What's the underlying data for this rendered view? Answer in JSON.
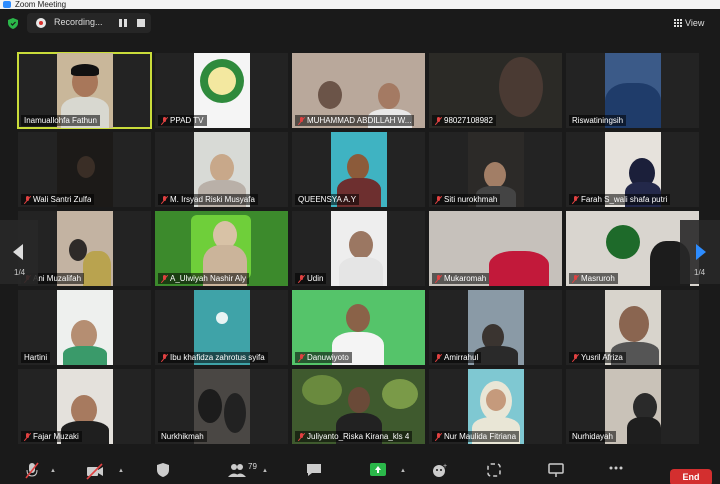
{
  "window": {
    "title": "Zoom Meeting"
  },
  "topbar": {
    "recording_label": "Recording...",
    "view_label": "View"
  },
  "nav": {
    "page_left": "1/4",
    "page_right": "1/4"
  },
  "participants": [
    {
      "name": "Inamuallohfa Fathun",
      "muted": false
    },
    {
      "name": "PPAD TV",
      "muted": true
    },
    {
      "name": "MUHAMMAD ABDILLAH W...",
      "muted": true
    },
    {
      "name": "98027108982",
      "muted": true
    },
    {
      "name": "Riswatiningsih",
      "muted": false
    },
    {
      "name": "Wali Santri Zulfa",
      "muted": true
    },
    {
      "name": "M. Irsyad Riski Musyafa",
      "muted": true
    },
    {
      "name": "QUEENSYA A.Y",
      "muted": false
    },
    {
      "name": "Siti nurokhmah",
      "muted": true
    },
    {
      "name": "Farah S_wali shafa putri",
      "muted": true
    },
    {
      "name": "Ani Muzalifah",
      "muted": true
    },
    {
      "name": "A_Ulwiyah Nashir Aly",
      "muted": true
    },
    {
      "name": "Udin",
      "muted": true
    },
    {
      "name": "Mukaromah",
      "muted": true
    },
    {
      "name": "Masruroh",
      "muted": true
    },
    {
      "name": "Hartini",
      "muted": false
    },
    {
      "name": "Ibu khafidza zahrotus syifa",
      "muted": true
    },
    {
      "name": "Danuwiyoto",
      "muted": true
    },
    {
      "name": "Amirrahul",
      "muted": true
    },
    {
      "name": "Yusril Afriza",
      "muted": true
    },
    {
      "name": "Fajar Muzaki",
      "muted": true
    },
    {
      "name": "Nurkhikmah",
      "muted": false
    },
    {
      "name": "Juliyanto_Riska Kirana_kls 4",
      "muted": true
    },
    {
      "name": "Nur Maulida Fitriana",
      "muted": true
    },
    {
      "name": "Nurhidayah",
      "muted": false
    }
  ],
  "toolbar": {
    "participants_count": "79",
    "end_label": "End"
  },
  "colors": {
    "accent": "#2d8cff",
    "active_speaker": "#c9dc3a",
    "end": "#d32f2f",
    "mute": "#e04141"
  }
}
